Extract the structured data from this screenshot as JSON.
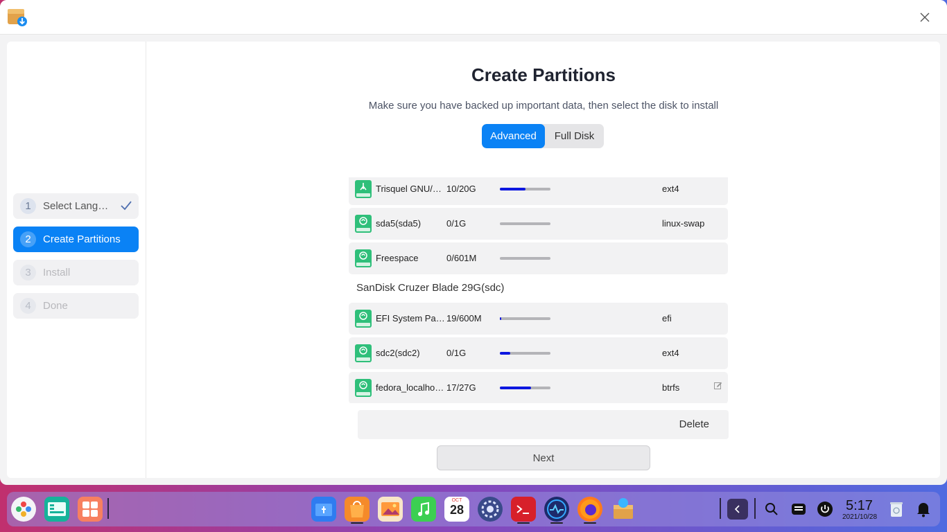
{
  "sidebar": {
    "steps": [
      {
        "num": "1",
        "label": "Select Langu…",
        "state": "done"
      },
      {
        "num": "2",
        "label": "Create Partitions",
        "state": "active"
      },
      {
        "num": "3",
        "label": "Install",
        "state": "disabled"
      },
      {
        "num": "4",
        "label": "Done",
        "state": "disabled"
      }
    ]
  },
  "main": {
    "title": "Create Partitions",
    "subtitle": "Make sure you have backed up important data, then select the disk to install",
    "tabs": [
      "Advanced",
      "Full Disk"
    ],
    "active_tab": "Advanced"
  },
  "partitions": [
    {
      "name": "Trisquel GNU/L…",
      "size": "10/20G",
      "usage": 0.5,
      "fs": "ext4",
      "icon": "trisquel-disk-icon"
    },
    {
      "name": "sda5(sda5)",
      "size": "0/1G",
      "usage": 0.0,
      "fs": "linux-swap",
      "icon": "disk-icon"
    },
    {
      "name": "Freespace",
      "size": "0/601M",
      "usage": 0.0,
      "fs": "",
      "icon": "disk-icon"
    }
  ],
  "disk2": {
    "label": "SanDisk Cruzer Blade 29G(sdc)",
    "partitions": [
      {
        "name": "EFI System Par…",
        "size": "19/600M",
        "usage": 0.03,
        "fs": "efi",
        "icon": "disk-icon"
      },
      {
        "name": "sdc2(sdc2)",
        "size": "0/1G",
        "usage": 0.2,
        "fs": "ext4",
        "icon": "disk-icon"
      },
      {
        "name": "fedora_localho…",
        "size": "17/27G",
        "usage": 0.62,
        "fs": "btrfs",
        "icon": "disk-icon"
      }
    ]
  },
  "actions": {
    "delete": "Delete",
    "next": "Next"
  },
  "taskbar": {
    "time": "5:17",
    "date": "2021/10/28",
    "calendar_month": "OCT",
    "calendar_day": "28",
    "apps": [
      "launcher-icon",
      "multitasking-icon",
      "app-store-icon",
      "file-manager-icon",
      "deepin-store-icon",
      "image-viewer-icon",
      "music-icon",
      "calendar-icon",
      "settings-icon",
      "terminal-icon",
      "system-monitor-icon",
      "firefox-icon",
      "installer-icon"
    ]
  },
  "colors": {
    "accent": "#0a82f5",
    "usage_fill": "#0d17e0"
  }
}
